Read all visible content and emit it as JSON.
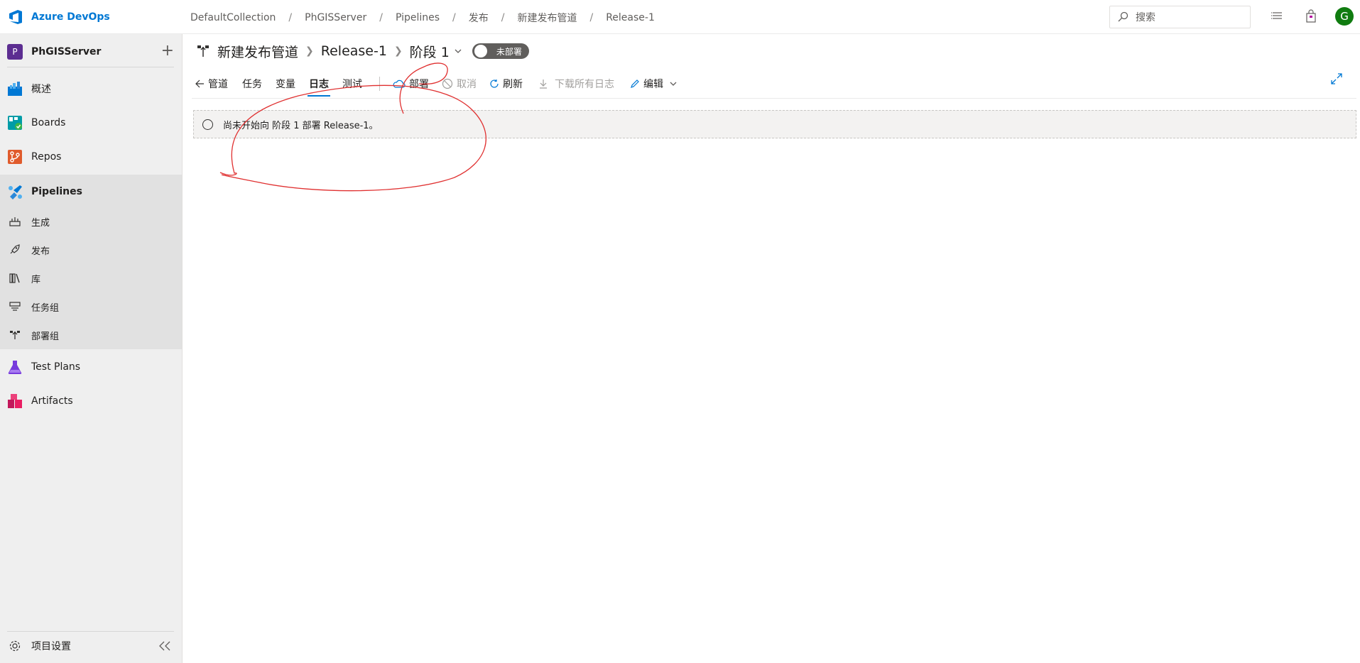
{
  "header": {
    "brand": "Azure DevOps",
    "breadcrumbs": [
      "DefaultCollection",
      "PhGISServer",
      "Pipelines",
      "发布",
      "新建发布管道",
      "Release-1"
    ],
    "breadcrumb_separator": "/",
    "search_placeholder": "搜索",
    "avatar_letter": "G",
    "icons": [
      "search-icon",
      "list-icon",
      "shopping-bag-icon"
    ]
  },
  "sidebar": {
    "project_initial": "P",
    "project_name": "PhGISServer",
    "add_symbol": "+",
    "items": [
      {
        "label": "概述",
        "icon": "overview-icon"
      },
      {
        "label": "Boards",
        "icon": "boards-icon"
      },
      {
        "label": "Repos",
        "icon": "repos-icon"
      },
      {
        "label": "Pipelines",
        "icon": "pipelines-icon"
      },
      {
        "label": "Test Plans",
        "icon": "test-plans-icon"
      },
      {
        "label": "Artifacts",
        "icon": "artifacts-icon"
      }
    ],
    "pipeline_subitems": [
      {
        "label": "生成",
        "icon": "builds-icon"
      },
      {
        "label": "发布",
        "icon": "releases-icon"
      },
      {
        "label": "库",
        "icon": "library-icon"
      },
      {
        "label": "任务组",
        "icon": "task-groups-icon"
      },
      {
        "label": "部署组",
        "icon": "deployment-groups-icon"
      }
    ],
    "settings_label": "项目设置"
  },
  "main": {
    "title_pipeline": "新建发布管道",
    "title_release": "Release-1",
    "title_stage": "阶段 1",
    "deploy_status": "未部署",
    "toolbar": {
      "back_label": "管道",
      "tabs": [
        "任务",
        "变量",
        "日志",
        "测试"
      ],
      "selected_tab": "日志",
      "deploy_label": "部署",
      "cancel_label": "取消",
      "refresh_label": "刷新",
      "download_label": "下载所有日志",
      "edit_label": "编辑"
    },
    "status_message": "尚未开始向 阶段 1 部署 Release-1。"
  },
  "colors": {
    "accent": "#0078d4",
    "annotation": "#e03030",
    "avatar": "#107c10",
    "project_badge": "#5c2d91"
  }
}
